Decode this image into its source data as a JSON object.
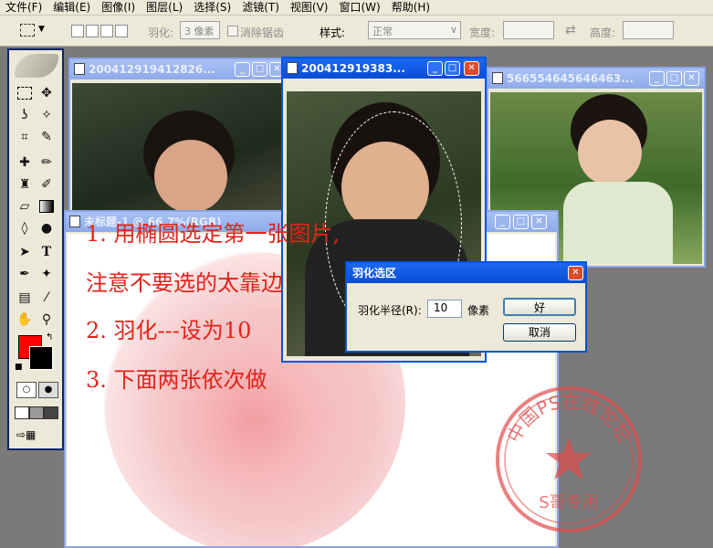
{
  "menu": [
    "文件(F)",
    "编辑(E)",
    "图像(I)",
    "图层(L)",
    "选择(S)",
    "滤镜(T)",
    "视图(V)",
    "窗口(W)",
    "帮助(H)"
  ],
  "options_bar": {
    "feather_label": "羽化:",
    "feather_value": "3 像素",
    "antialias_label": "消除锯齿",
    "style_label": "样式:",
    "style_value": "正常",
    "width_label": "宽度:",
    "height_label": "高度:"
  },
  "windows": {
    "left_title": "200412919412826...",
    "middle_title": "200412919383...",
    "right_title": "566554645646463...",
    "canvas_title": "未标题-1 @ 66.7%(RGB)"
  },
  "instructions": [
    "1. 用椭圆选定第一张图片,",
    "注意不要选的太靠边",
    "2. 羽化---设为10",
    "3. 下面两张依次做"
  ],
  "dialog": {
    "title": "羽化选区",
    "radius_label": "羽化半径(R):",
    "radius_value": "10",
    "unit": "像素",
    "ok": "好",
    "cancel": "取消"
  },
  "watermark": {
    "top_text": "中国PS在线论坛",
    "bottom_text": "S哥专用"
  },
  "colors": {
    "foreground": "#ff0000",
    "background": "#000000",
    "annotation": "#e2231a",
    "title_active": "#0a4bd6"
  }
}
